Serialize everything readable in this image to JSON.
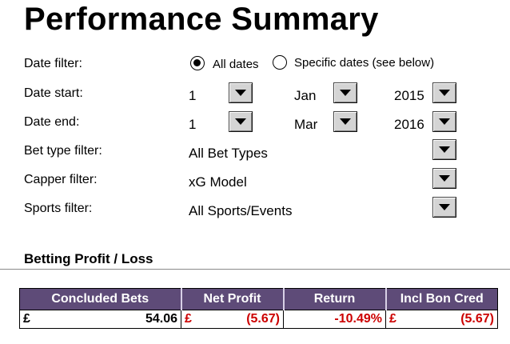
{
  "page": {
    "title": "Performance Summary"
  },
  "filters": {
    "date_filter": {
      "label": "Date filter:",
      "options": [
        {
          "label": "All dates",
          "selected": true
        },
        {
          "label": "Specific dates (see below)",
          "selected": false
        }
      ]
    },
    "date_start": {
      "label": "Date start:",
      "day": "1",
      "month": "Jan",
      "year": "2015"
    },
    "date_end": {
      "label": "Date end:",
      "day": "1",
      "month": "Mar",
      "year": "2016"
    },
    "bet_type": {
      "label": "Bet type filter:",
      "value": "All Bet Types"
    },
    "capper": {
      "label": "Capper filter:",
      "value": "xG Model"
    },
    "sports": {
      "label": "Sports filter:",
      "value": "All Sports/Events"
    }
  },
  "profit_loss": {
    "heading": "Betting Profit / Loss",
    "columns": [
      "Concluded Bets",
      "Net Profit",
      "Return",
      "Incl Bon Cred"
    ],
    "row": {
      "concluded_bets": {
        "currency": "£",
        "amount": "54.06"
      },
      "net_profit": {
        "currency": "£",
        "amount": "(5.67)"
      },
      "return": {
        "value": "-10.49%"
      },
      "incl_bon_cred": {
        "currency": "£",
        "amount": "(5.67)"
      }
    }
  },
  "colors": {
    "header_bg": "#5e4b78",
    "header_text": "#ffffff",
    "negative": "#cc0000"
  },
  "icons": {
    "dropdown": "chevron-down-icon",
    "radio_selected": "radio-selected-icon",
    "radio_unselected": "radio-unselected-icon"
  }
}
